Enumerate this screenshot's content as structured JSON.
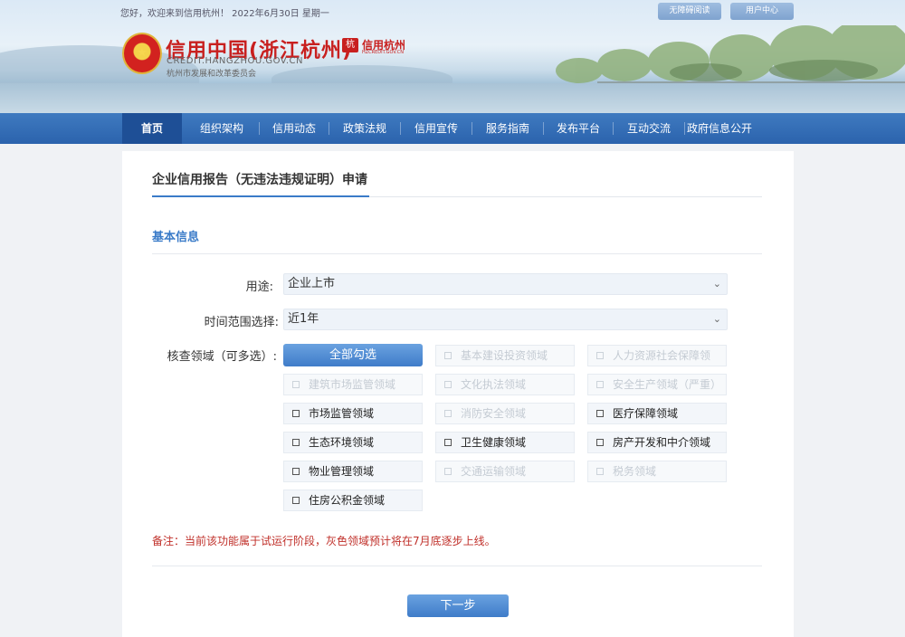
{
  "header": {
    "greeting": "您好，欢迎来到信用杭州！ 2022年6月30日 星期一",
    "accessibility_label": "无障碍阅读",
    "user_center_label": "用户中心",
    "emblem_glyph": "★",
    "logo_cn": "信用中国(浙江杭州)",
    "logo_en": "CREDIT.HANGZHOU.GOV.CN",
    "logo_sub": "杭州市发展和改革委员会",
    "mark_glyph": "杭",
    "mark_cn": "信用杭州",
    "mark_en": "HZCREDIT.GOV.CN"
  },
  "nav": {
    "items": [
      {
        "label": "首页",
        "active": true
      },
      {
        "label": "组织架构"
      },
      {
        "label": "信用动态"
      },
      {
        "label": "政策法规"
      },
      {
        "label": "信用宣传"
      },
      {
        "label": "服务指南"
      },
      {
        "label": "发布平台"
      },
      {
        "label": "互动交流"
      },
      {
        "label": "政府信息公开"
      }
    ]
  },
  "form": {
    "page_title": "企业信用报告（无违法违规证明）申请",
    "section_title": "基本信息",
    "purpose_label": "用途:",
    "purpose_value": "企业上市",
    "range_label": "时间范围选择:",
    "range_value": "近1年",
    "chevron": "⌄",
    "domains_label": "核查领域（可多选）:",
    "select_all_label": "全部勾选",
    "domains": [
      {
        "label": "基本建设投资领域",
        "disabled": true
      },
      {
        "label": "人力资源社会保障领",
        "disabled": true
      },
      {
        "label": "建筑市场监管领域",
        "disabled": true
      },
      {
        "label": "文化执法领域",
        "disabled": true
      },
      {
        "label": "安全生产领域（严重）",
        "disabled": true
      },
      {
        "label": "市场监管领域",
        "disabled": false
      },
      {
        "label": "消防安全领域",
        "disabled": true
      },
      {
        "label": "医疗保障领域",
        "disabled": false
      },
      {
        "label": "生态环境领域",
        "disabled": false
      },
      {
        "label": "卫生健康领域",
        "disabled": false
      },
      {
        "label": "房产开发和中介领域",
        "disabled": false
      },
      {
        "label": "物业管理领域",
        "disabled": false
      },
      {
        "label": "交通运输领域",
        "disabled": true
      },
      {
        "label": "税务领域",
        "disabled": true
      },
      {
        "label": "住房公积金领域",
        "disabled": false
      }
    ],
    "note": "备注：当前该功能属于试运行阶段，灰色领域预计将在7月底逐步上线。",
    "next_label": "下一步"
  }
}
